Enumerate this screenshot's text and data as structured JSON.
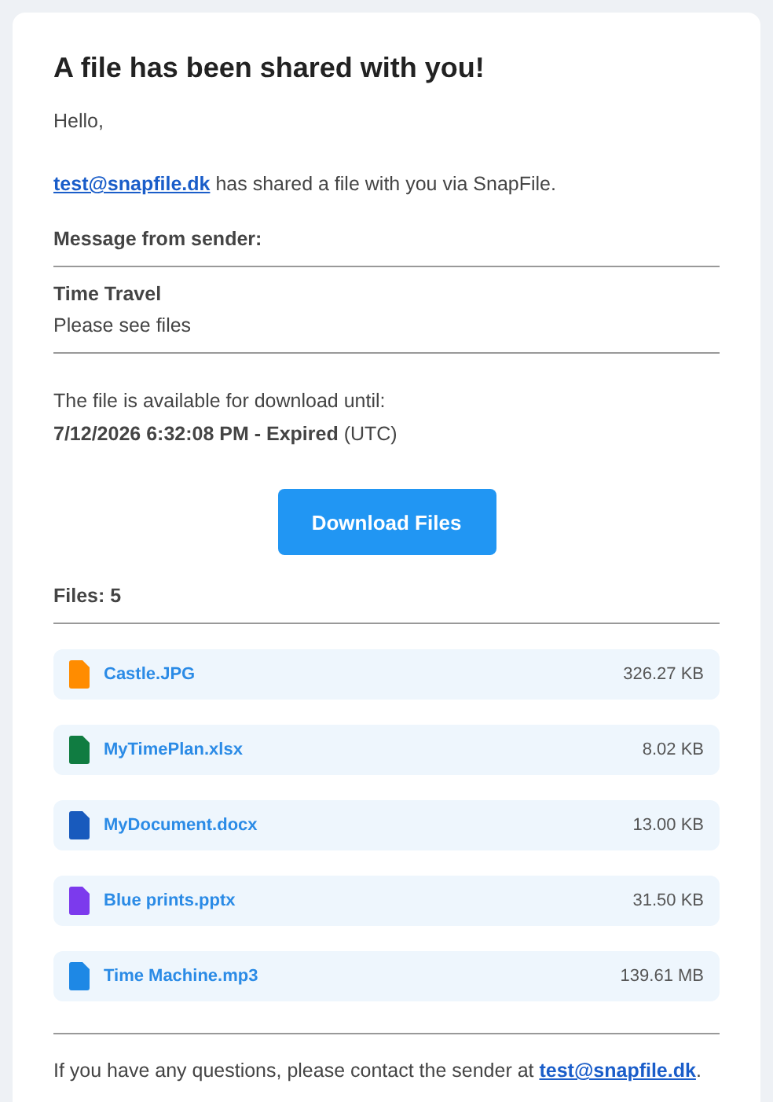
{
  "title": "A file has been shared with you!",
  "greeting": "Hello,",
  "share_line": {
    "sender_link": "test@snapfile.dk",
    "text": "has shared a file with you via SnapFile."
  },
  "message_label": "Message from sender:",
  "message": {
    "subject": "Time Travel",
    "body": "Please see files"
  },
  "availability": {
    "text": "The file is available for download until:",
    "date": "**7/12/2026 6:32:08 PM - Expired** (UTC)"
  },
  "download_button": "Download Files",
  "files_label": "Files: 5",
  "files": [
    {
      "name": "Castle.JPG",
      "size": "326.27 KB",
      "color": "#ff8c00"
    },
    {
      "name": "MyTimePlan.xlsx",
      "size": "8.02 KB",
      "color": "#107c41"
    },
    {
      "name": "MyDocument.docx",
      "size": "13.00 KB",
      "color": "#185abd"
    },
    {
      "name": "Blue prints.pptx",
      "size": "31.50 KB",
      "color": "#7c3aed"
    },
    {
      "name": "Time Machine.mp3",
      "size": "139.61 MB",
      "color": "#1e88e5"
    }
  ],
  "footer": {
    "text": "If you have any questions, please contact the sender at",
    "link": "test@snapfile.dk",
    "end": "."
  }
}
